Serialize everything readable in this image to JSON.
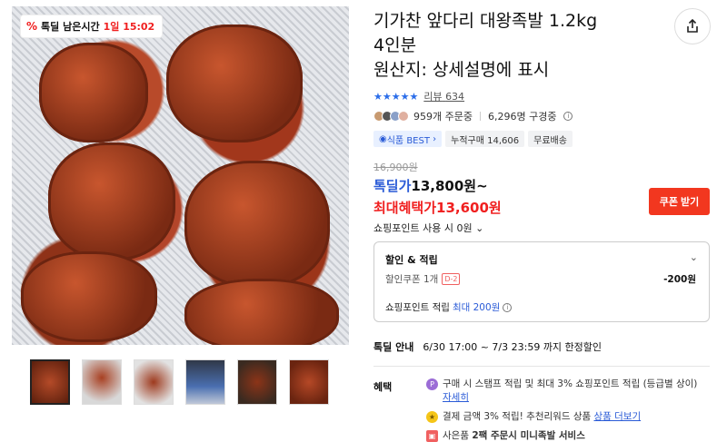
{
  "timer": {
    "label": "톡딜 남은시간",
    "time": "1일 15:02"
  },
  "product": {
    "title_line1": "기가찬 앞다리 대왕족발 1.2kg",
    "title_line2": "4인분",
    "title_line3": "원산지: 상세설명에 표시",
    "stars": "★★★★★",
    "review_label": "리뷰",
    "review_count": "634",
    "orders": "959개 주문중",
    "buyers": "6,296명 구경중",
    "chips": [
      "식품 BEST",
      "누적구매 14,606",
      "무료배송"
    ]
  },
  "price": {
    "original": "16,900원",
    "deal_label": "톡딜가",
    "deal_value": "13,800원~",
    "max_label": "최대혜택가",
    "max_value": "13,600원",
    "coupon_button": "쿠폰 받기",
    "point_use": "쇼핑포인트 사용 시 0원"
  },
  "benefit_box": {
    "header": "할인 & 적립",
    "coupon_label": "할인쿠폰 1개",
    "coupon_badge": "D-2",
    "coupon_value": "-200원",
    "point_label": "쇼핑포인트 적립",
    "point_max": "최대 200원"
  },
  "deal_info": {
    "label": "톡딜 안내",
    "value": "6/30 17:00 ~ 7/3 23:59 까지 한정할인"
  },
  "benefits": {
    "label": "혜택",
    "item1_text": "구매 시 스탬프 적립 및 최대 3% 쇼핑포인트 적립 (등급별 상이)",
    "item1_link": "자세히",
    "item2_text": "결제 금액 3% 적립! 추천리워드 상품",
    "item2_link": "상품 더보기",
    "item3_pre": "사은품",
    "item3_bold": "2팩 주문시 미니족발 서비스"
  },
  "colors": {
    "accent_blue": "#2a5bd7",
    "accent_red": "#f02020",
    "coupon_red": "#f2371f"
  }
}
